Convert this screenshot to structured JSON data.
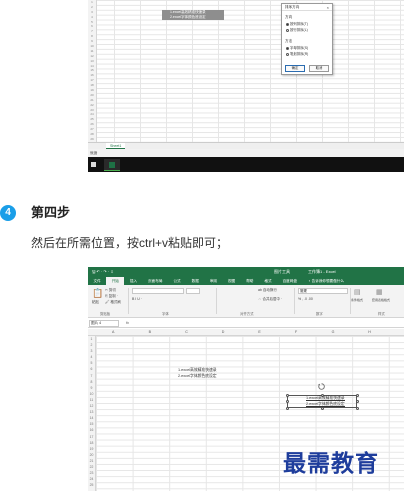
{
  "top_screenshot": {
    "row_numbers": [
      "1",
      "2",
      "3",
      "4",
      "5",
      "6",
      "7",
      "8",
      "9",
      "10",
      "11",
      "12",
      "13",
      "14",
      "15",
      "16",
      "17",
      "18",
      "19",
      "20",
      "21",
      "22",
      "23",
      "24",
      "25",
      "26",
      "27",
      "28",
      "29"
    ],
    "copied_cells": [
      "1.excel高效精准快速录",
      "2.excel字体颜色底设定"
    ],
    "dialog": {
      "title": "排序方向",
      "close": "×",
      "group1_title": "方向",
      "group1_options": [
        "按列排序(T)",
        "按行排序(L)"
      ],
      "group2_title": "方法",
      "group2_options": [
        "字母排序(S)",
        "笔划排序(R)"
      ],
      "ok": "确定",
      "cancel": "取消"
    },
    "sheet_tab": "Sheet1",
    "status": "就绪"
  },
  "step": {
    "number": "4",
    "title": "第四步",
    "instruction": "然后在所需位置，按ctrl+v粘贴即可；"
  },
  "bottom_screenshot": {
    "titlebar": {
      "quick_access": "🖫  ↶ · ↷ ·  ⇩",
      "context_tab": "图片工具",
      "filename": "工作簿1 - Excel"
    },
    "menu": [
      "文件",
      "开始",
      "插入",
      "页面布局",
      "公式",
      "数据",
      "审阅",
      "视图",
      "帮助",
      "格式",
      "百度网盘",
      "♀ 告诉我你想要做什么"
    ],
    "active_menu_index": 1,
    "ribbon": {
      "paste": "粘贴",
      "cut": "✂ 剪切",
      "copy": "⎘ 复制 ·",
      "format_painter": "🖌 格式刷",
      "group_clipboard": "剪贴板",
      "group_font": "字体",
      "group_align": "对齐方式",
      "group_number": "数字",
      "group_styles": "样式",
      "bold_italic": "B  I  U  ·",
      "wrap": "ab 自动换行",
      "merge": "⇔ 合并后居中 ·",
      "general": "常规",
      "currency": "% ,  .0  .00",
      "cond_format": "条件格式",
      "table_format": "套用表格格式"
    },
    "name_box": "图片 4",
    "fx": "fx",
    "columns": [
      "A",
      "B",
      "C",
      "D",
      "E",
      "F",
      "G",
      "H",
      "I",
      "J",
      "K",
      "L",
      "M"
    ],
    "row_numbers": [
      "1",
      "2",
      "3",
      "4",
      "5",
      "6",
      "7",
      "8",
      "9",
      "10",
      "11",
      "12",
      "13",
      "14",
      "15",
      "16",
      "17",
      "18",
      "19",
      "20",
      "21",
      "22",
      "23",
      "24",
      "25"
    ],
    "cell_lines": [
      "1.excel高效精准快速录",
      "2.excel字体颜色底设定"
    ],
    "pasted_lines": [
      "1.excel高效精准快速录",
      "2.excel字体颜色底设定"
    ]
  },
  "watermark": "最需教育"
}
